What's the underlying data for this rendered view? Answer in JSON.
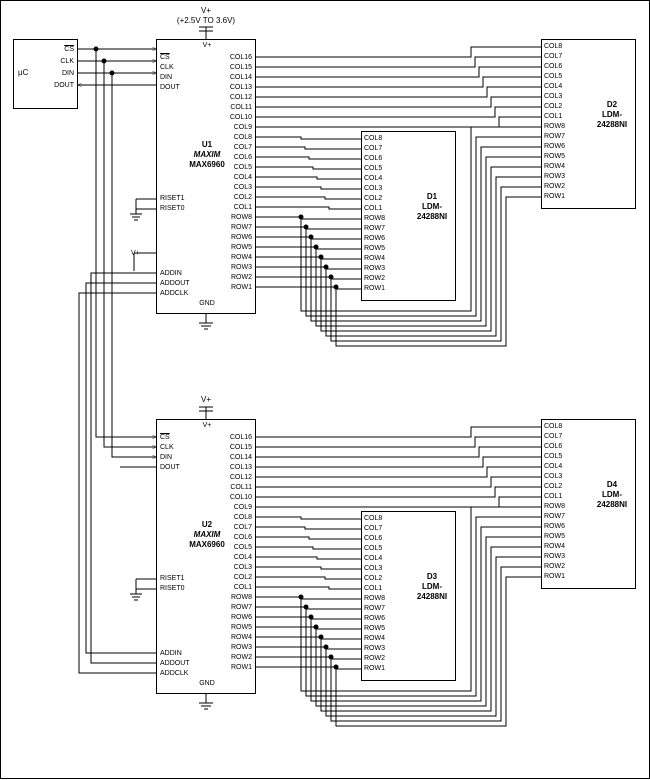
{
  "power": {
    "vplus": "V+",
    "range": "(+2.5V TO 3.6V)"
  },
  "micro": {
    "name": "µC",
    "pins": {
      "cs": "CS",
      "clk": "CLK",
      "din": "DIN",
      "dout": "DOUT"
    }
  },
  "u1": {
    "ref": "U1",
    "vendor": "MAXIM",
    "part": "MAX6960",
    "left": {
      "vplus": "V+",
      "cs": "CS",
      "clk": "CLK",
      "din": "DIN",
      "dout": "DOUT",
      "riset1": "RISET1",
      "riset0": "RISET0",
      "addin": "ADDIN",
      "addout": "ADDOUT",
      "addclk": "ADDCLK"
    },
    "right": {
      "col16": "COL16",
      "col15": "COL15",
      "col14": "COL14",
      "col13": "COL13",
      "col12": "COL12",
      "col11": "COL11",
      "col10": "COL10",
      "col9": "COL9",
      "col8": "COL8",
      "col7": "COL7",
      "col6": "COL6",
      "col5": "COL5",
      "col4": "COL4",
      "col3": "COL3",
      "col2": "COL2",
      "col1": "COL1",
      "row8": "ROW8",
      "row7": "ROW7",
      "row6": "ROW6",
      "row5": "ROW5",
      "row4": "ROW4",
      "row3": "ROW3",
      "row2": "ROW2",
      "row1": "ROW1"
    },
    "gnd": "GND"
  },
  "u2": {
    "ref": "U2",
    "vendor": "MAXIM",
    "part": "MAX6960",
    "left": {
      "vplus": "V+",
      "cs": "CS",
      "clk": "CLK",
      "din": "DIN",
      "dout": "DOUT",
      "riset1": "RISET1",
      "riset0": "RISET0",
      "addin": "ADDIN",
      "addout": "ADDOUT",
      "addclk": "ADDCLK"
    },
    "right": {
      "col16": "COL16",
      "col15": "COL15",
      "col14": "COL14",
      "col13": "COL13",
      "col12": "COL12",
      "col11": "COL11",
      "col10": "COL10",
      "col9": "COL9",
      "col8": "COL8",
      "col7": "COL7",
      "col6": "COL6",
      "col5": "COL5",
      "col4": "COL4",
      "col3": "COL3",
      "col2": "COL2",
      "col1": "COL1",
      "row8": "ROW8",
      "row7": "ROW7",
      "row6": "ROW6",
      "row5": "ROW5",
      "row4": "ROW4",
      "row3": "ROW3",
      "row2": "ROW2",
      "row1": "ROW1"
    },
    "gnd": "GND"
  },
  "d1": {
    "ref": "D1",
    "part": "LDM-",
    "part2": "24288NI",
    "pins": {
      "col8": "COL8",
      "col7": "COL7",
      "col6": "COL6",
      "col5": "COL5",
      "col4": "COL4",
      "col3": "COL3",
      "col2": "COL2",
      "col1": "COL1",
      "row8": "ROW8",
      "row7": "ROW7",
      "row6": "ROW6",
      "row5": "ROW5",
      "row4": "ROW4",
      "row3": "ROW3",
      "row2": "ROW2",
      "row1": "ROW1"
    }
  },
  "d2": {
    "ref": "D2",
    "part": "LDM-",
    "part2": "24288NI",
    "pins": {
      "col8": "COL8",
      "col7": "COL7",
      "col6": "COL6",
      "col5": "COL5",
      "col4": "COL4",
      "col3": "COL3",
      "col2": "COL2",
      "col1": "COL1",
      "row8": "ROW8",
      "row7": "ROW7",
      "row6": "ROW6",
      "row5": "ROW5",
      "row4": "ROW4",
      "row3": "ROW3",
      "row2": "ROW2",
      "row1": "ROW1"
    }
  },
  "d3": {
    "ref": "D3",
    "part": "LDM-",
    "part2": "24288NI",
    "pins": {
      "col8": "COL8",
      "col7": "COL7",
      "col6": "COL6",
      "col5": "COL5",
      "col4": "COL4",
      "col3": "COL3",
      "col2": "COL2",
      "col1": "COL1",
      "row8": "ROW8",
      "row7": "ROW7",
      "row6": "ROW6",
      "row5": "ROW5",
      "row4": "ROW4",
      "row3": "ROW3",
      "row2": "ROW2",
      "row1": "ROW1"
    }
  },
  "d4": {
    "ref": "D4",
    "part": "LDM-",
    "part2": "24288NI",
    "pins": {
      "col8": "COL8",
      "col7": "COL7",
      "col6": "COL6",
      "col5": "COL5",
      "col4": "COL4",
      "col3": "COL3",
      "col2": "COL2",
      "col1": "COL1",
      "row8": "ROW8",
      "row7": "ROW7",
      "row6": "ROW6",
      "row5": "ROW5",
      "row4": "ROW4",
      "row3": "ROW3",
      "row2": "ROW2",
      "row1": "ROW1"
    }
  },
  "misc": {
    "vplus_decouple": "V+",
    "gnd_sym": "GND"
  }
}
